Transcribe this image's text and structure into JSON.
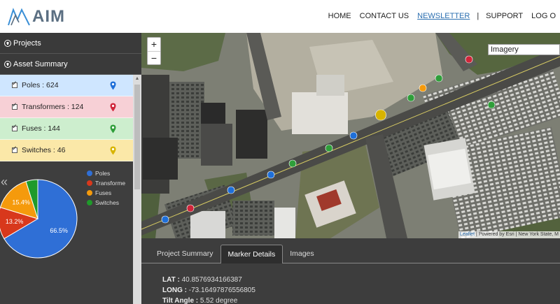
{
  "header": {
    "logo_text": "AIM",
    "nav": [
      {
        "label": "HOME",
        "active": false
      },
      {
        "label": "CONTACT US",
        "active": false
      },
      {
        "label": "NEWSLETTER",
        "active": true
      },
      {
        "label": "|",
        "separator": true
      },
      {
        "label": "SUPPORT",
        "active": false
      },
      {
        "label": "LOG O",
        "active": false
      }
    ]
  },
  "sidebar": {
    "projects_label": "Projects",
    "asset_summary_label": "Asset Summary",
    "assets": [
      {
        "label": "Poles : 624",
        "bg": "#cfe6ff",
        "pin_color": "#1e6fd9"
      },
      {
        "label": "Transformers : 124",
        "bg": "#f7d0d6",
        "pin_color": "#d0253a"
      },
      {
        "label": "Fuses : 144",
        "bg": "#cdeece",
        "pin_color": "#2f9e3a"
      },
      {
        "label": "Switches : 46",
        "bg": "#fbe8a8",
        "pin_color": "#d8b400"
      }
    ]
  },
  "chart_data": {
    "type": "pie",
    "slices": [
      {
        "name": "Poles",
        "value": 66.5,
        "label": "66.5%",
        "color": "#2f6fd6"
      },
      {
        "name": "Transforme",
        "value": 13.2,
        "label": "13.2%",
        "color": "#d8381c"
      },
      {
        "name": "Fuses",
        "value": 15.4,
        "label": "15.4%",
        "color": "#f59a0c"
      },
      {
        "name": "Switches",
        "value": 4.9,
        "label": "",
        "color": "#1f9a2a"
      }
    ],
    "legend": [
      "Poles",
      "Transforme",
      "Fuses",
      "Switches"
    ],
    "legend_position": "right"
  },
  "map": {
    "zoom_in": "+",
    "zoom_out": "−",
    "layer": "Imagery",
    "attribution_leaflet": "Leaflet",
    "attribution_rest": " | Powered by Esri | New York State, M",
    "markers": [
      {
        "color": "#d0253a"
      },
      {
        "color": "#f59a0c"
      },
      {
        "color": "#2f9e3a"
      },
      {
        "color": "#2f9e3a"
      },
      {
        "color": "#d8b400"
      },
      {
        "color": "#1e6fd9"
      },
      {
        "color": "#2f9e3a"
      },
      {
        "color": "#2f9e3a"
      },
      {
        "color": "#1e6fd9"
      },
      {
        "color": "#1e6fd9"
      },
      {
        "color": "#d0253a"
      },
      {
        "color": "#1e6fd9"
      },
      {
        "color": "#2f9e3a"
      }
    ]
  },
  "bottom": {
    "tabs": [
      {
        "label": "Project Summary",
        "active": false
      },
      {
        "label": "Marker Details",
        "active": true
      },
      {
        "label": "Images",
        "active": false
      }
    ],
    "lat_label": "LAT : ",
    "lat_value": "40.8576934166387",
    "long_label": "LONG : ",
    "long_value": "-73.16497876556805",
    "tilt_label": "Tilt Angle : ",
    "tilt_value": "5.52 degree"
  }
}
